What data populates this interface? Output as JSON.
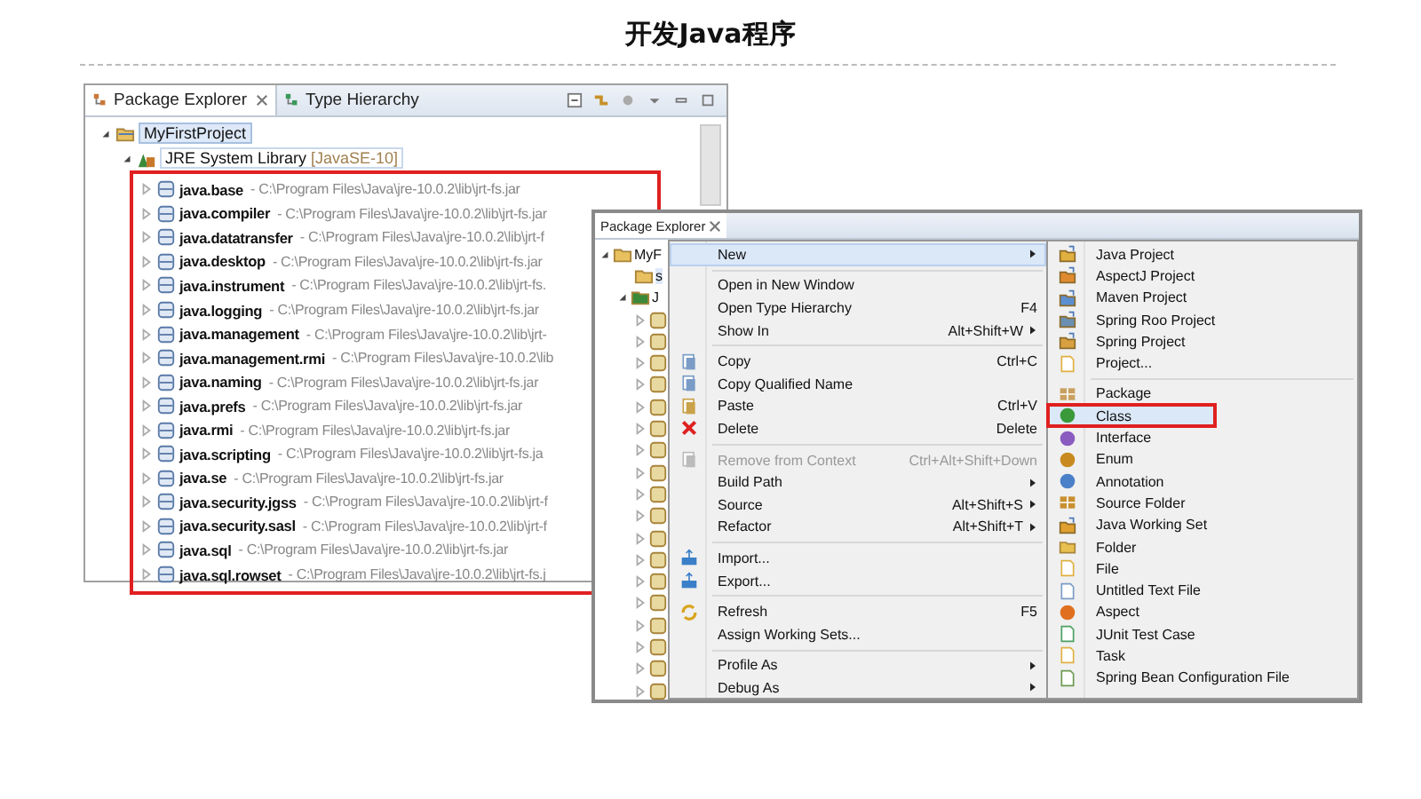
{
  "title": "开发Java程序",
  "package_explorer": {
    "tabs": [
      {
        "label": "Package Explorer",
        "selected": true,
        "closable": true
      },
      {
        "label": "Type Hierarchy",
        "selected": false,
        "closable": false
      }
    ],
    "tree": [
      {
        "label": "MyFirstProject",
        "selected": true,
        "expanded": true,
        "children": [
          {
            "label": "JRE System Library",
            "decoration": "[JavaSE-10]",
            "selected": false,
            "expanded": true,
            "annotated": true,
            "children": [
              {
                "label": "java.base",
                "path": "- C:\\Program Files\\Java\\jre-10.0.2\\lib\\jrt-fs.jar",
                "selected": false,
                "expanded": false
              },
              {
                "label": "java.compiler",
                "path": "- C:\\Program Files\\Java\\jre-10.0.2\\lib\\jrt-fs.jar",
                "selected": false,
                "expanded": false
              },
              {
                "label": "java.datatransfer",
                "path": "- C:\\Program Files\\Java\\jre-10.0.2\\lib\\jrt-f",
                "selected": false,
                "expanded": false
              },
              {
                "label": "java.desktop",
                "path": "- C:\\Program Files\\Java\\jre-10.0.2\\lib\\jrt-fs.jar",
                "selected": false,
                "expanded": false
              },
              {
                "label": "java.instrument",
                "path": "- C:\\Program Files\\Java\\jre-10.0.2\\lib\\jrt-fs.",
                "selected": false,
                "expanded": false
              },
              {
                "label": "java.logging",
                "path": "- C:\\Program Files\\Java\\jre-10.0.2\\lib\\jrt-fs.jar",
                "selected": false,
                "expanded": false
              },
              {
                "label": "java.management",
                "path": "- C:\\Program Files\\Java\\jre-10.0.2\\lib\\jrt-",
                "selected": false,
                "expanded": false
              },
              {
                "label": "java.management.rmi",
                "path": "- C:\\Program Files\\Java\\jre-10.0.2\\lib",
                "selected": false,
                "expanded": false
              },
              {
                "label": "java.naming",
                "path": "- C:\\Program Files\\Java\\jre-10.0.2\\lib\\jrt-fs.jar",
                "selected": false,
                "expanded": false
              },
              {
                "label": "java.prefs",
                "path": "- C:\\Program Files\\Java\\jre-10.0.2\\lib\\jrt-fs.jar",
                "selected": false,
                "expanded": false
              },
              {
                "label": "java.rmi",
                "path": "- C:\\Program Files\\Java\\jre-10.0.2\\lib\\jrt-fs.jar",
                "selected": false,
                "expanded": false
              },
              {
                "label": "java.scripting",
                "path": "- C:\\Program Files\\Java\\jre-10.0.2\\lib\\jrt-fs.ja",
                "selected": false,
                "expanded": false
              },
              {
                "label": "java.se",
                "path": "- C:\\Program Files\\Java\\jre-10.0.2\\lib\\jrt-fs.jar",
                "selected": false,
                "expanded": false
              },
              {
                "label": "java.security.jgss",
                "path": "- C:\\Program Files\\Java\\jre-10.0.2\\lib\\jrt-f",
                "selected": false,
                "expanded": false
              },
              {
                "label": "java.security.sasl",
                "path": "- C:\\Program Files\\Java\\jre-10.0.2\\lib\\jrt-f",
                "selected": false,
                "expanded": false
              },
              {
                "label": "java.sql",
                "path": "- C:\\Program Files\\Java\\jre-10.0.2\\lib\\jrt-fs.jar",
                "selected": false,
                "expanded": false
              },
              {
                "label": "java.sql.rowset",
                "path": "- C:\\Program Files\\Java\\jre-10.0.2\\lib\\jrt-fs.j",
                "selected": false,
                "expanded": false
              }
            ]
          }
        ]
      }
    ]
  },
  "second_view": {
    "tab": {
      "label": "Package Explorer",
      "closable": true
    },
    "tree": [
      {
        "label": "MyF",
        "selected": false,
        "expanded": true
      },
      {
        "label": "s",
        "selected": true,
        "expanded": false
      },
      {
        "label": "J",
        "selected": false,
        "expanded": true
      }
    ],
    "context_menu": [
      {
        "kind": "item",
        "label": "New",
        "submenu": true,
        "disabled": false,
        "selected": true
      },
      {
        "kind": "separator"
      },
      {
        "kind": "item",
        "label": "Open in New Window",
        "submenu": false,
        "disabled": false,
        "selected": false
      },
      {
        "kind": "item",
        "label": "Open Type Hierarchy",
        "shortcut": "F4",
        "submenu": false,
        "disabled": false,
        "selected": false
      },
      {
        "kind": "item",
        "label": "Show In",
        "shortcut": "Alt+Shift+W",
        "submenu": true,
        "disabled": false,
        "selected": false
      },
      {
        "kind": "separator"
      },
      {
        "kind": "item",
        "label": "Copy",
        "shortcut": "Ctrl+C",
        "submenu": false,
        "disabled": false,
        "selected": false
      },
      {
        "kind": "item",
        "label": "Copy Qualified Name",
        "submenu": false,
        "disabled": false,
        "selected": false
      },
      {
        "kind": "item",
        "label": "Paste",
        "shortcut": "Ctrl+V",
        "submenu": false,
        "disabled": false,
        "selected": false
      },
      {
        "kind": "item",
        "label": "Delete",
        "shortcut": "Delete",
        "submenu": false,
        "disabled": false,
        "selected": false
      },
      {
        "kind": "separator"
      },
      {
        "kind": "item",
        "label": "Remove from Context",
        "shortcut": "Ctrl+Alt+Shift+Down",
        "submenu": false,
        "disabled": true,
        "selected": false
      },
      {
        "kind": "item",
        "label": "Build Path",
        "submenu": true,
        "disabled": false,
        "selected": false
      },
      {
        "kind": "item",
        "label": "Source",
        "shortcut": "Alt+Shift+S",
        "submenu": true,
        "disabled": false,
        "selected": false
      },
      {
        "kind": "item",
        "label": "Refactor",
        "shortcut": "Alt+Shift+T",
        "submenu": true,
        "disabled": false,
        "selected": false
      },
      {
        "kind": "separator"
      },
      {
        "kind": "item",
        "label": "Import...",
        "submenu": false,
        "disabled": false,
        "selected": false
      },
      {
        "kind": "item",
        "label": "Export...",
        "submenu": false,
        "disabled": false,
        "selected": false
      },
      {
        "kind": "separator"
      },
      {
        "kind": "item",
        "label": "Refresh",
        "shortcut": "F5",
        "submenu": false,
        "disabled": false,
        "selected": false
      },
      {
        "kind": "item",
        "label": "Assign Working Sets...",
        "submenu": false,
        "disabled": false,
        "selected": false
      },
      {
        "kind": "separator"
      },
      {
        "kind": "item",
        "label": "Profile As",
        "submenu": true,
        "disabled": false,
        "selected": false
      },
      {
        "kind": "item",
        "label": "Debug As",
        "submenu": true,
        "disabled": false,
        "selected": false
      }
    ],
    "new_submenu": [
      {
        "kind": "item",
        "label": "Java Project",
        "selected": false
      },
      {
        "kind": "item",
        "label": "AspectJ Project",
        "selected": false
      },
      {
        "kind": "item",
        "label": "Maven Project",
        "selected": false
      },
      {
        "kind": "item",
        "label": "Spring Roo Project",
        "selected": false
      },
      {
        "kind": "item",
        "label": "Spring Project",
        "selected": false
      },
      {
        "kind": "item",
        "label": "Project...",
        "selected": false
      },
      {
        "kind": "separator"
      },
      {
        "kind": "item",
        "label": "Package",
        "selected": false
      },
      {
        "kind": "item",
        "label": "Class",
        "selected": true,
        "annotated": true
      },
      {
        "kind": "item",
        "label": "Interface",
        "selected": false
      },
      {
        "kind": "item",
        "label": "Enum",
        "selected": false
      },
      {
        "kind": "item",
        "label": "Annotation",
        "selected": false
      },
      {
        "kind": "item",
        "label": "Source Folder",
        "selected": false
      },
      {
        "kind": "item",
        "label": "Java Working Set",
        "selected": false
      },
      {
        "kind": "item",
        "label": "Folder",
        "selected": false
      },
      {
        "kind": "item",
        "label": "File",
        "selected": false
      },
      {
        "kind": "item",
        "label": "Untitled Text File",
        "selected": false
      },
      {
        "kind": "item",
        "label": "Aspect",
        "selected": false
      },
      {
        "kind": "item",
        "label": "JUnit Test Case",
        "selected": false
      },
      {
        "kind": "item",
        "label": "Task",
        "selected": false
      },
      {
        "kind": "item",
        "label": "Spring Bean Configuration File",
        "selected": false
      }
    ]
  }
}
